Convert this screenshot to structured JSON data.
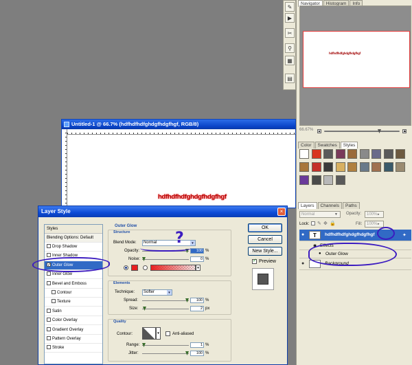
{
  "tool_strip": {
    "icons": [
      "brush-icon",
      "play-icon",
      "history-icon",
      "scissors-icon",
      "tool-preset-icon",
      "file-browser-icon",
      "document-icon"
    ]
  },
  "navigator": {
    "tabs": [
      "Navigator",
      "Histogram",
      "Info"
    ],
    "thumb_text": "hdfhdfhdfghdgfhdgfhgf",
    "zoom": "66.67%"
  },
  "styles_panel": {
    "tabs": [
      "Color",
      "Swatches",
      "Styles"
    ],
    "swatch_colors": [
      "#ffffff",
      "#d8351f",
      "#5a5a5a",
      "#7a3a5a",
      "#9a6a3a",
      "#8a8a8a",
      "#6a6a8a",
      "#5a5a5a",
      "#6d5a40",
      "#a8763c",
      "#c4302a",
      "#3a3a3a",
      "#d8b060",
      "#b08040",
      "#6a7a8a",
      "#a07050",
      "#3a5a6a",
      "#9a8a70",
      "#6a3a9a",
      "#4a4a4a",
      "#b8b8b8",
      "#5a5a5a"
    ]
  },
  "layers_panel": {
    "tabs": [
      "Layers",
      "Channels",
      "Paths"
    ],
    "blend_mode": "Normal",
    "opacity_label": "Opacity:",
    "opacity_value": "100%",
    "lock_label": "Lock:",
    "fill_label": "Fill:",
    "fill_value": "100%",
    "text_thumb": "T",
    "text_layer_name": "hdfhdfhdfghdgfhdgfhgf",
    "effects_label": "Effects",
    "outer_glow_label": "Outer Glow",
    "background_name": "Background"
  },
  "document": {
    "title": "Untitled-1 @ 66.7% (hdfhdfhdfghdgfhdgfhgf, RGB/8)",
    "canvas_text": "hdfhdfhdfghdgfhdgfhgf"
  },
  "dialog": {
    "title": "Layer Style",
    "close_glyph": "×",
    "list": {
      "styles": "Styles",
      "blending": "Blending Options: Default",
      "items": [
        {
          "label": "Drop Shadow",
          "checked": false,
          "indent": false
        },
        {
          "label": "Inner Shadow",
          "checked": false,
          "indent": false
        },
        {
          "label": "Outer Glow",
          "checked": true,
          "indent": false
        },
        {
          "label": "Inner Glow",
          "checked": false,
          "indent": false
        },
        {
          "label": "Bevel and Emboss",
          "checked": false,
          "indent": false
        },
        {
          "label": "Contour",
          "checked": false,
          "indent": true
        },
        {
          "label": "Texture",
          "checked": false,
          "indent": true
        },
        {
          "label": "Satin",
          "checked": false,
          "indent": false
        },
        {
          "label": "Color Overlay",
          "checked": false,
          "indent": false
        },
        {
          "label": "Gradient Overlay",
          "checked": false,
          "indent": false
        },
        {
          "label": "Pattern Overlay",
          "checked": false,
          "indent": false
        },
        {
          "label": "Stroke",
          "checked": false,
          "indent": false
        }
      ]
    },
    "outer_glow": {
      "title": "Outer Glow",
      "structure": "Structure",
      "blend_mode_label": "Blend Mode:",
      "blend_mode": "Normal",
      "opacity_label": "Opacity:",
      "opacity": "100",
      "noise_label": "Noise:",
      "noise": "0",
      "percent": "%",
      "glow_color": "#e82020",
      "elements": "Elements",
      "technique_label": "Technique:",
      "technique": "Softer",
      "spread_label": "Spread:",
      "spread": "100",
      "size_label": "Size:",
      "size": "2",
      "px": "px",
      "quality": "Quality",
      "contour_label": "Contour:",
      "anti_aliased": "Anti-aliased",
      "range_label": "Range:",
      "range": "1",
      "jitter_label": "Jitter:",
      "jitter": "100"
    },
    "buttons": {
      "ok": "OK",
      "cancel": "Cancel",
      "new_style": "New Style...",
      "preview": "Preview"
    },
    "annotation_mark": "?"
  }
}
